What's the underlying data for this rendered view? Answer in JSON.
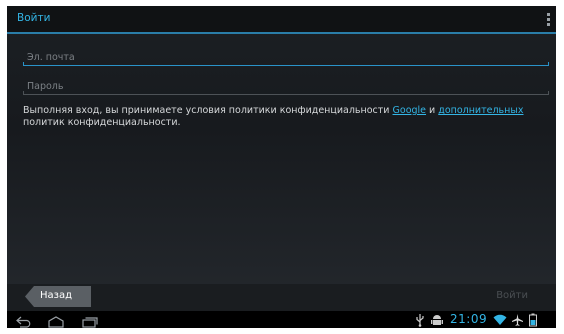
{
  "actionbar": {
    "title": "Войти",
    "overflow_icon": "overflow-menu-icon"
  },
  "form": {
    "email": {
      "placeholder": "Эл. почта",
      "value": ""
    },
    "password": {
      "placeholder": "Пароль",
      "value": ""
    }
  },
  "terms": {
    "text_before": "Выполняя вход, вы принимаете условия политики конфиденциальности ",
    "link_google": "Google",
    "text_middle": " и ",
    "link_additional": "дополнительных",
    "text_after": " политик конфиденциальности."
  },
  "buttons": {
    "back_label": "Назад",
    "signin_label": "Войти"
  },
  "navbar": {
    "icons": [
      "back-icon",
      "home-icon",
      "recent-apps-icon",
      "usb-icon",
      "android-debug-icon",
      "wifi-icon",
      "airplane-mode-icon",
      "battery-icon"
    ],
    "clock": "21:09"
  },
  "colors": {
    "accent": "#33b5e5",
    "background": "#1c2024"
  }
}
